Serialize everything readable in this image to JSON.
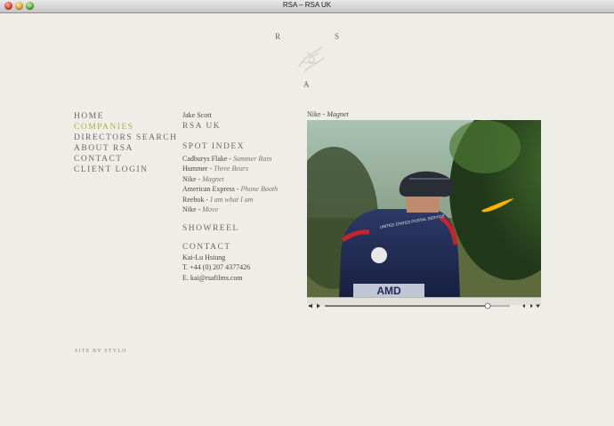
{
  "window": {
    "title": "RSA – RSA UK"
  },
  "logo": {
    "r": "R",
    "s": "S",
    "a": "A"
  },
  "nav": [
    "HOME",
    "COMPANIES",
    "DIRECTORS SEARCH",
    "ABOUT RSA",
    "CONTACT",
    "CLIENT LOGIN"
  ],
  "nav_active_index": 1,
  "director": {
    "name": "Jake Scott",
    "company": "RSA UK"
  },
  "spot_index": {
    "heading": "SPOT INDEX",
    "items": [
      {
        "brand": "Cadburys Flake",
        "title": "Summer Rain"
      },
      {
        "brand": "Hummer",
        "title": "Three Bears"
      },
      {
        "brand": "Nike",
        "title": "Magnet"
      },
      {
        "brand": "American Express",
        "title": "Phone Booth"
      },
      {
        "brand": "Reebok",
        "title": "I am what I am"
      },
      {
        "brand": "Nike",
        "title": "Move"
      }
    ],
    "separator": " - "
  },
  "showreel": {
    "heading": "SHOWREEL"
  },
  "contact": {
    "heading": "CONTACT",
    "name": "Kai-Lu Hsiung",
    "phone": "T. +44 (0) 207 4377426",
    "email": "E. kai@rsafilms.com"
  },
  "video": {
    "brand": "Nike",
    "title": "Magnet",
    "separator": " - ",
    "jersey_text": "UNITED STATES POSTAL SERVICE",
    "jersey_logo": "AMD",
    "helmet_color": "#2a2d36",
    "swoosh_color": "#f5b400",
    "progress": 0.88
  },
  "footer": {
    "credit": "SITE BY STYLO"
  },
  "colors": {
    "accent": "#a9b23d",
    "background": "#efede8"
  }
}
